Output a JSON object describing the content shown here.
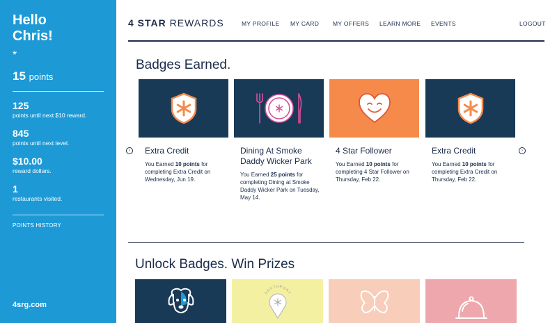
{
  "sidebar": {
    "greeting_line1": "Hello",
    "greeting_line2": "Chris!",
    "star": "*",
    "points_value": "15",
    "points_unit": "points",
    "stats": [
      {
        "value": "125",
        "label": "points until next $10 reward."
      },
      {
        "value": "845",
        "label": "points until next level."
      },
      {
        "value": "$10.00",
        "label": "reward dollars."
      },
      {
        "value": "1",
        "label": "restaurants visited."
      }
    ],
    "history_link": "POINTS HISTORY",
    "site": "4srg.com"
  },
  "header": {
    "logo_strong": "4 STAR",
    "logo_light": "REWARDS",
    "nav": [
      "MY PROFILE",
      "MY CARD",
      "MY OFFERS",
      "LEARN MORE",
      "EVENTS"
    ],
    "logout": "LOGOUT"
  },
  "badges_section": {
    "title": "Badges Earned.",
    "badges": [
      {
        "title": "Extra Credit",
        "prefix": "You Earned ",
        "points": "10 points",
        "suffix": " for completing Extra Credit on Wednesday, Jun 19."
      },
      {
        "title": "Dining At Smoke Daddy Wicker Park",
        "prefix": "You Earned ",
        "points": "25 points",
        "suffix": " for completing Dining at Smoke Daddy Wicker Park on Tuesday, May 14."
      },
      {
        "title": "4 Star Follower",
        "prefix": "You Earned ",
        "points": "10 points",
        "suffix": " for completing 4 Star Follower on Thursday, Feb 22."
      },
      {
        "title": "Extra Credit",
        "prefix": "You Earned ",
        "points": "10 points",
        "suffix": " for completing Extra Credit on Thursday, Feb 22."
      }
    ],
    "prev_arrow": "‹",
    "next_arrow": "›"
  },
  "prizes_section": {
    "title": "Unlock Badges. Win Prizes",
    "badge_text": "SOUTHPORT"
  },
  "colors": {
    "sidebar_blue": "#1d9ad6",
    "navy": "#193a57",
    "orange": "#f58a4b",
    "yellow": "#f4f0a2",
    "peach": "#f8cdb9",
    "pink": "#eea8ad"
  }
}
